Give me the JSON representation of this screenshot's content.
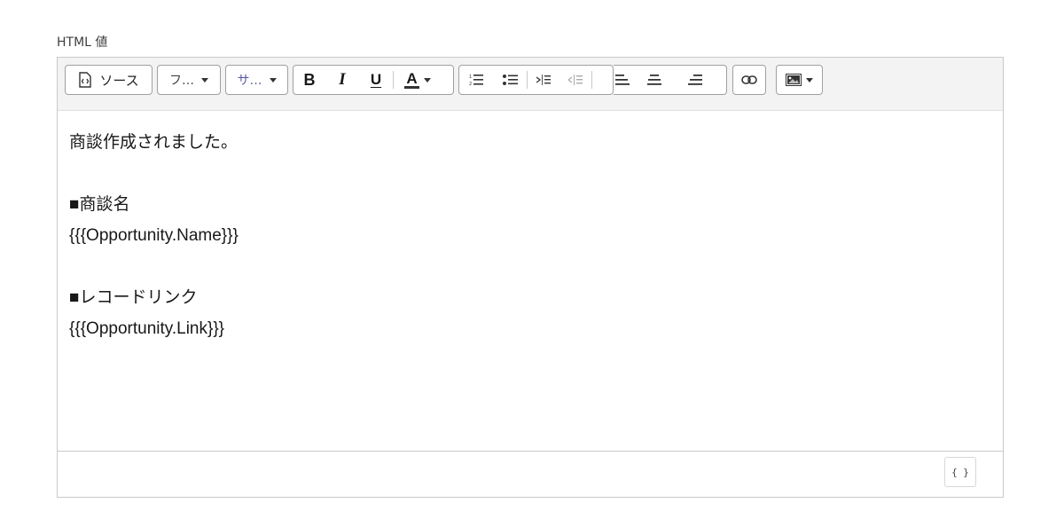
{
  "field_label": "HTML 値",
  "toolbar": {
    "source_label": "ソース",
    "font_family_label": "フ…",
    "font_size_label": "サ…",
    "icons": [
      "source-icon",
      "bold-icon",
      "italic-icon",
      "underline-icon",
      "text-color-icon",
      "ordered-list-icon",
      "unordered-list-icon",
      "indent-icon",
      "outdent-icon",
      "align-left-icon",
      "align-center-icon",
      "align-right-icon",
      "link-icon",
      "image-icon"
    ]
  },
  "content": {
    "lines": [
      "商談作成されました。",
      "",
      "■商談名",
      "{{{Opportunity.Name}}}",
      "",
      "■レコードリンク",
      "{{{Opportunity.Link}}}"
    ]
  },
  "footer": {
    "merge_field_label": "{ }"
  }
}
